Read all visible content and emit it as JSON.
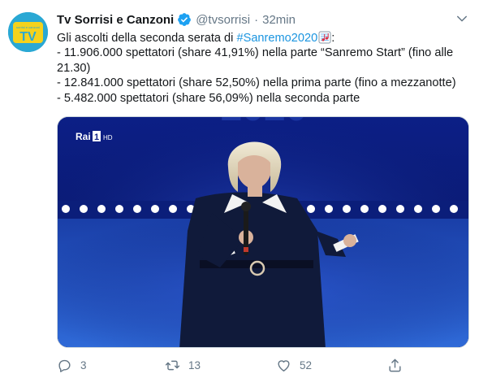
{
  "account": {
    "name": "Tv Sorrisi e Canzoni",
    "handle": "@tvsorrisi",
    "separator": "·",
    "time": "32min",
    "avatar_text": "TV",
    "avatar_small_text": "sorrisi e canzoni"
  },
  "tweet": {
    "line1_text": "Gli ascolti della seconda serata di ",
    "line1_hashtag": "#Sanremo2020",
    "line1_suffix": ":",
    "line2": "- 11.906.000 spettatori (share 41,91%) nella parte “Sanremo Start” (fino alle",
    "line3": "21.30)",
    "line4": "- 12.841.000 spettatori (share 52,50%) nella prima parte (fino a mezzanotte)",
    "line5": "- 5.482.000 spettatori (share 56,09%) nella seconda parte"
  },
  "media": {
    "channel_logo": "Rai",
    "channel_number": "1",
    "channel_hd": "HD"
  },
  "actions": {
    "replies": "3",
    "retweets": "13",
    "likes": "52"
  },
  "colors": {
    "accent": "#1b95e0",
    "verified": "#1da1f2",
    "muted": "#657786",
    "avatar_bg": "#2aa8d4",
    "logo_yellow": "#f5d21c"
  }
}
